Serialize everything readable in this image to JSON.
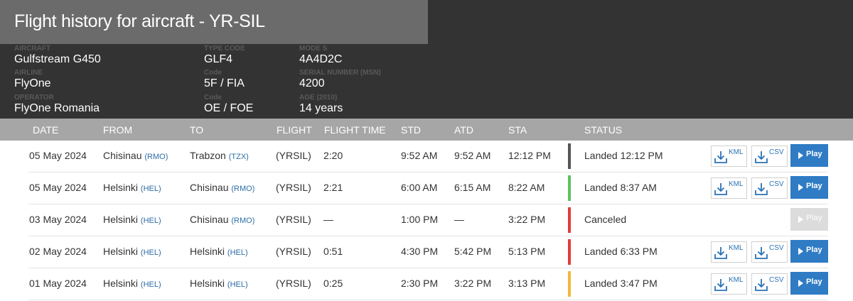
{
  "page_title": "Flight history for aircraft - YR-SIL",
  "aircraft_info": {
    "aircraft_label": "AIRCRAFT",
    "aircraft_value": "Gulfstream G450",
    "airline_label": "AIRLINE",
    "airline_value": "FlyOne",
    "operator_label": "OPERATOR",
    "operator_value": "FlyOne Romania",
    "type_code_label": "TYPE CODE",
    "type_code_value": "GLF4",
    "airline_code_label": "Code",
    "airline_code_value": "5F / FIA",
    "operator_code_label": "Code",
    "operator_code_value": "OE / FOE",
    "mode_s_label": "MODE S",
    "mode_s_value": "4A4D2C",
    "serial_label": "SERIAL NUMBER (MSN)",
    "serial_value": "4200",
    "age_label": "AGE (2010)",
    "age_value": "14 years"
  },
  "table": {
    "headers": [
      "DATE",
      "FROM",
      "TO",
      "FLIGHT",
      "FLIGHT TIME",
      "STD",
      "ATD",
      "STA",
      "STATUS"
    ],
    "buttons": {
      "kml": "KML",
      "csv": "CSV",
      "play": "Play"
    },
    "status_colors": {
      "grey": "#555555",
      "green": "#5cc25c",
      "red": "#e03c3c",
      "yellow": "#f2b83a"
    },
    "rows": [
      {
        "date": "05 May 2024",
        "from": "Chisinau",
        "from_code": "(RMO)",
        "to": "Trabzon",
        "to_code": "(TZX)",
        "flight": "(YRSIL)",
        "flight_time": "2:20",
        "std": "9:52 AM",
        "atd": "9:52 AM",
        "sta": "12:12 PM",
        "status": "Landed 12:12 PM",
        "status_color": "#555555"
      },
      {
        "date": "05 May 2024",
        "from": "Helsinki",
        "from_code": "(HEL)",
        "to": "Chisinau",
        "to_code": "(RMO)",
        "flight": "(YRSIL)",
        "flight_time": "2:21",
        "std": "6:00 AM",
        "atd": "6:15 AM",
        "sta": "8:22 AM",
        "status": "Landed 8:37 AM",
        "status_color": "#5cc25c"
      },
      {
        "date": "03 May 2024",
        "from": "Helsinki",
        "from_code": "(HEL)",
        "to": "Chisinau",
        "to_code": "(RMO)",
        "flight": "(YRSIL)",
        "flight_time": "—",
        "std": "1:00 PM",
        "atd": "—",
        "sta": "3:22 PM",
        "status": "Canceled",
        "status_color": "#e03c3c"
      },
      {
        "date": "02 May 2024",
        "from": "Helsinki",
        "from_code": "(HEL)",
        "to": "Helsinki",
        "to_code": "(HEL)",
        "flight": "(YRSIL)",
        "flight_time": "0:51",
        "std": "4:30 PM",
        "atd": "5:42 PM",
        "sta": "5:13 PM",
        "status": "Landed 6:33 PM",
        "status_color": "#e03c3c"
      },
      {
        "date": "01 May 2024",
        "from": "Helsinki",
        "from_code": "(HEL)",
        "to": "Helsinki",
        "to_code": "(HEL)",
        "flight": "(YRSIL)",
        "flight_time": "0:25",
        "std": "2:30 PM",
        "atd": "3:22 PM",
        "sta": "3:13 PM",
        "status": "Landed 3:47 PM",
        "status_color": "#f2b83a"
      }
    ]
  }
}
